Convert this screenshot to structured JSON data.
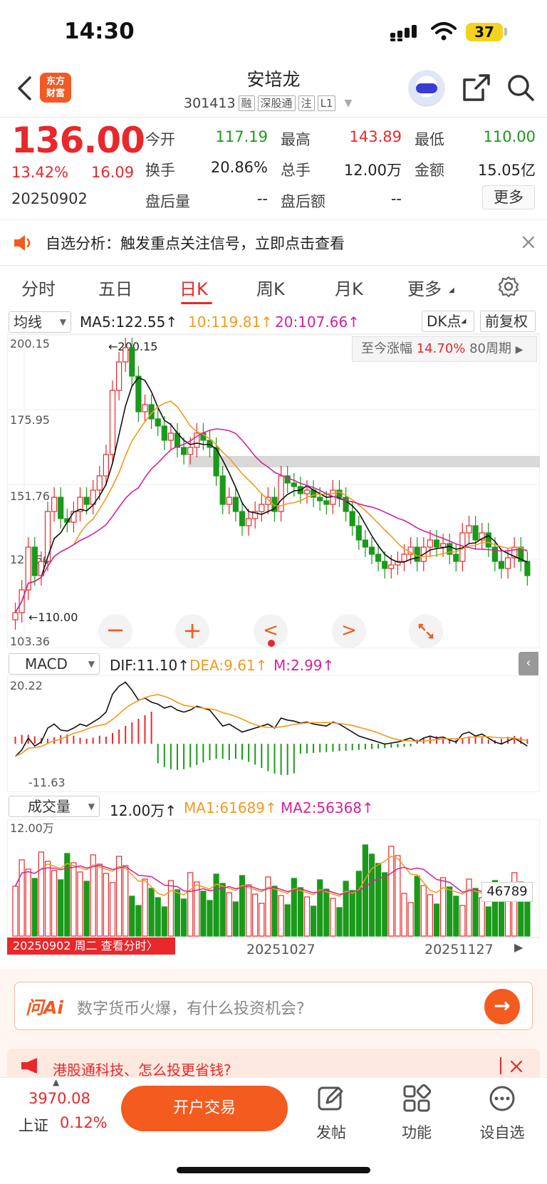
{
  "status_bar": {
    "time": "14:30",
    "battery": "37"
  },
  "header": {
    "logo_text_1": "东方",
    "logo_text_2": "财富",
    "stock_name": "安培龙",
    "stock_code": "301413",
    "tags": [
      "融",
      "深股通",
      "注",
      "L1"
    ]
  },
  "quote": {
    "price": "136.00",
    "change_pct": "13.42%",
    "change": "16.09",
    "date": "20250902",
    "rows": [
      [
        {
          "label": "今开",
          "value": "117.19",
          "color": "green"
        },
        {
          "label": "最高",
          "value": "143.89",
          "color": "red"
        },
        {
          "label": "最低",
          "value": "110.00",
          "color": "green"
        }
      ],
      [
        {
          "label": "换手",
          "value": "20.86%",
          "color": "dark"
        },
        {
          "label": "总手",
          "value": "12.00万",
          "color": "dark"
        },
        {
          "label": "金额",
          "value": "15.05亿",
          "color": "dark"
        }
      ],
      [
        {
          "label": "盘后量",
          "value": "--",
          "color": "dark"
        },
        {
          "label": "盘后额",
          "value": "--",
          "color": "dark"
        }
      ]
    ],
    "more_label": "更多"
  },
  "notice": {
    "text": "自选分析：触发重点关注信号，立即点击查看"
  },
  "tabs": [
    "分时",
    "五日",
    "日K",
    "周K",
    "月K",
    "更多"
  ],
  "kline": {
    "indicator_select": "均线",
    "ma5": "MA5:122.55↑",
    "ma10": "10:119.81↑",
    "ma20": "20:107.66↑",
    "dk_label": "DK点",
    "adjust_label": "前复权",
    "y_labels": [
      "200.15",
      "175.95",
      "151.76",
      "127.56",
      "103.36"
    ],
    "high_marker": "←200.15",
    "low_marker": "←110.00",
    "range_label": "至今涨幅",
    "range_value": "14.70%",
    "range_period": "80周期"
  },
  "macd": {
    "select": "MACD",
    "dif": "DIF:11.10↑",
    "dea": "DEA:9.61↑",
    "m": "M:2.99↑",
    "y_top": "20.22",
    "y_bottom": "-11.63"
  },
  "volume": {
    "select": "成交量",
    "total": "12.00万↑",
    "ma1": "MA1:61689↑",
    "ma2": "MA2:56368↑",
    "y_top": "12.00万",
    "last_value": "46789",
    "date_tag": "20250902 周二 查看分时",
    "x_labels": [
      "20251027",
      "20251127"
    ]
  },
  "ai": {
    "logo": "问Ai",
    "placeholder": "数字货币火爆，有什么投资机会?"
  },
  "promo": {
    "text": "港股通科技、怎么投更省钱?"
  },
  "bottom": {
    "index_value": "3970.08",
    "index_name": "上证",
    "index_pct": "0.12%",
    "trade_label": "开户交易",
    "items": [
      "发帖",
      "功能",
      "设自选"
    ]
  },
  "colors": {
    "up": "#e8282b",
    "down": "#1a9a1a",
    "ma5": "#111111",
    "ma10": "#f39a1e",
    "ma20": "#d4239b",
    "accent": "#f35b1f"
  }
}
